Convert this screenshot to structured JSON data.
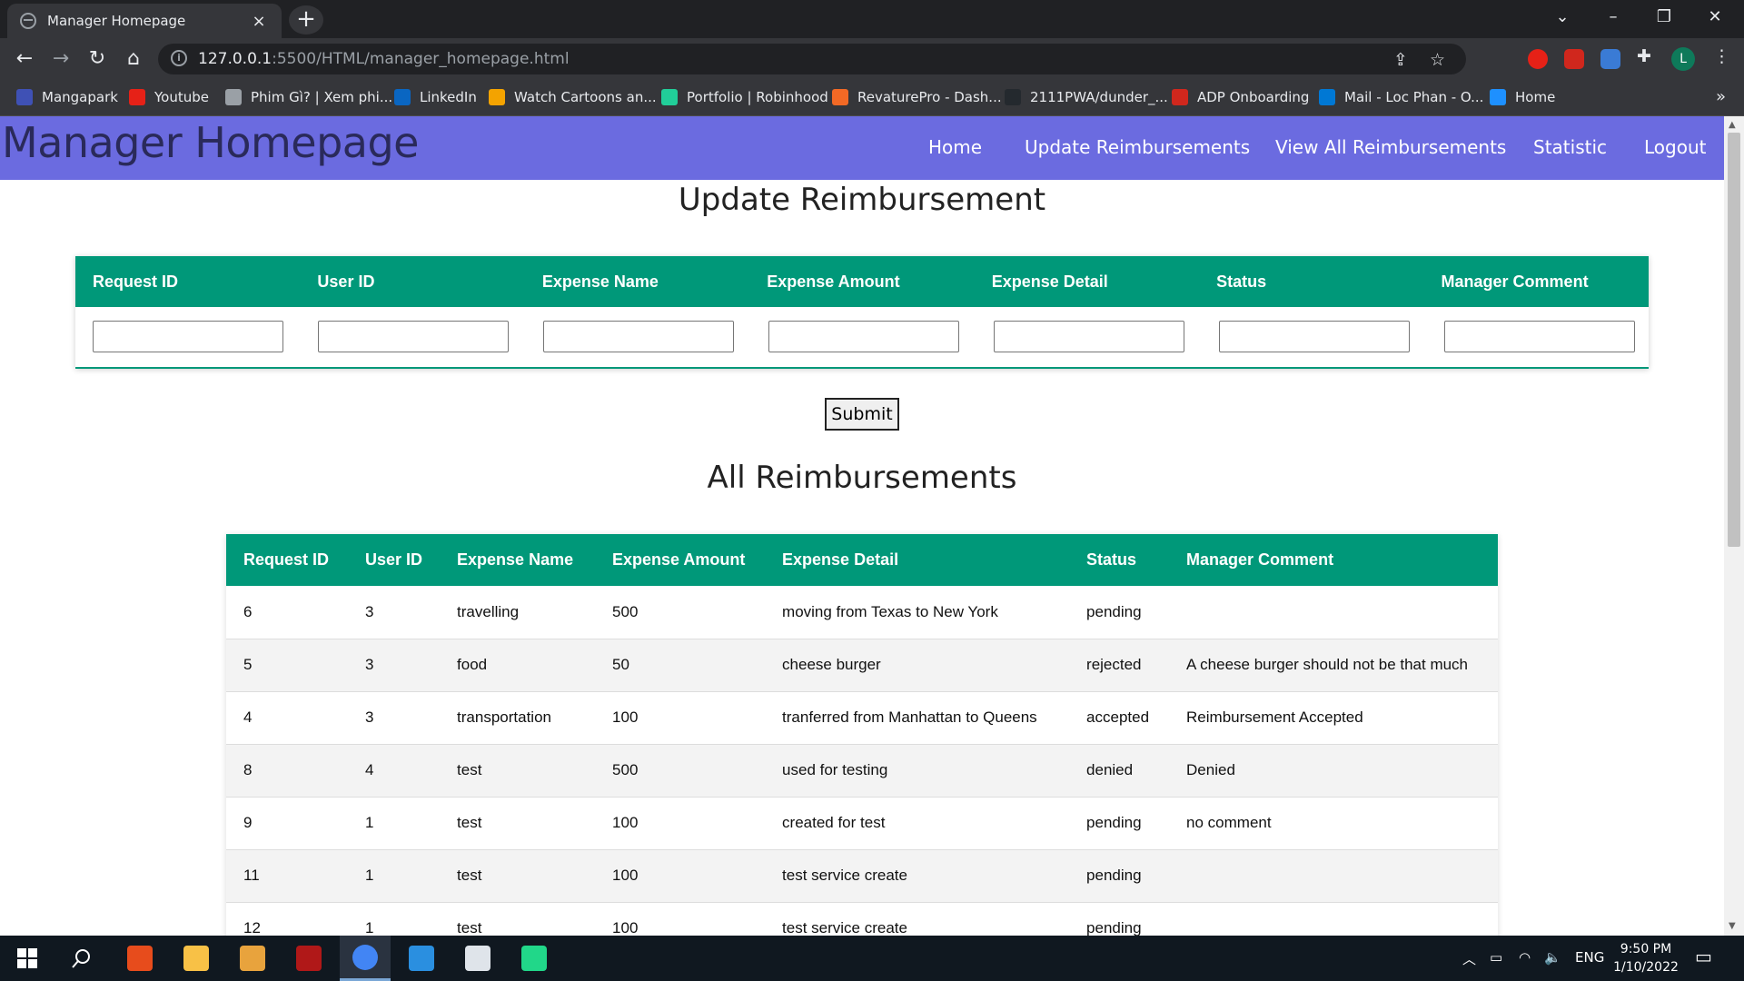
{
  "browser": {
    "tab_title": "Manager Homepage",
    "tab_close": "×",
    "new_tab": "+",
    "url_host": "127.0.0.1",
    "url_rest": ":5500/HTML/manager_homepage.html",
    "profile_initial": "L",
    "window_controls": {
      "chevron": "⌄",
      "minimize": "–",
      "restore": "❐",
      "close": "✕"
    },
    "nav": {
      "back": "←",
      "forward": "→",
      "reload": "↻",
      "home": "⌂"
    },
    "bookmarks": [
      {
        "label": "Mangapark",
        "icon": "mangapark-icon",
        "color": "#3f51b5"
      },
      {
        "label": "Youtube",
        "icon": "youtube-icon",
        "color": "#e62117"
      },
      {
        "label": "Phim Gì? | Xem phi...",
        "icon": "globe-icon",
        "color": "#9aa0a6"
      },
      {
        "label": "LinkedIn",
        "icon": "linkedin-icon",
        "color": "#0a66c2"
      },
      {
        "label": "Watch Cartoons an...",
        "icon": "cartoon-icon",
        "color": "#f4a300"
      },
      {
        "label": "Portfolio | Robinhood",
        "icon": "robinhood-icon",
        "color": "#21ce99"
      },
      {
        "label": "RevaturePro - Dash...",
        "icon": "revature-icon",
        "color": "#f26925"
      },
      {
        "label": "2111PWA/dunder_...",
        "icon": "github-icon",
        "color": "#24292e"
      },
      {
        "label": "ADP Onboarding",
        "icon": "adp-icon",
        "color": "#d0271d"
      },
      {
        "label": "Mail - Loc Phan - O...",
        "icon": "outlook-icon",
        "color": "#0078d4"
      },
      {
        "label": "Home",
        "icon": "cloud-icon",
        "color": "#1e90ff"
      }
    ],
    "bookmarks_more": "»"
  },
  "app": {
    "title": "Manager Homepage",
    "nav": [
      "Home",
      "Update Reimbursements",
      "View All Reimbursements",
      "Statistic",
      "Logout"
    ]
  },
  "update_section": {
    "title": "Update Reimbursement",
    "headers": [
      "Request ID",
      "User ID",
      "Expense Name",
      "Expense Amount",
      "Expense Detail",
      "Status",
      "Manager Comment"
    ],
    "values": [
      "",
      "",
      "",
      "",
      "",
      "",
      ""
    ],
    "submit_label": "Submit"
  },
  "all_section": {
    "title": "All Reimbursements",
    "headers": [
      "Request ID",
      "User ID",
      "Expense Name",
      "Expense Amount",
      "Expense Detail",
      "Status",
      "Manager Comment"
    ],
    "rows": [
      [
        "6",
        "3",
        "travelling",
        "500",
        "moving from Texas to New York",
        "pending",
        ""
      ],
      [
        "5",
        "3",
        "food",
        "50",
        "cheese burger",
        "rejected",
        "A cheese burger should not be that much"
      ],
      [
        "4",
        "3",
        "transportation",
        "100",
        "tranferred from Manhattan to Queens",
        "accepted",
        "Reimbursement Accepted"
      ],
      [
        "8",
        "4",
        "test",
        "500",
        "used for testing",
        "denied",
        "Denied"
      ],
      [
        "9",
        "1",
        "test",
        "100",
        "created for test",
        "pending",
        "no comment"
      ],
      [
        "11",
        "1",
        "test",
        "100",
        "test service create",
        "pending",
        ""
      ],
      [
        "12",
        "1",
        "test",
        "100",
        "test service create",
        "pending",
        ""
      ]
    ]
  },
  "taskbar": {
    "apps": [
      {
        "name": "office-icon",
        "color": "#e74c1c"
      },
      {
        "name": "file-explorer-icon",
        "color": "#f8c146"
      },
      {
        "name": "git-icon",
        "color": "#e8a33d"
      },
      {
        "name": "predator-icon",
        "color": "#b01818"
      },
      {
        "name": "chrome-icon",
        "color": "#4285f4"
      },
      {
        "name": "vscode-icon",
        "color": "#2a8fe0"
      },
      {
        "name": "pgadmin-icon",
        "color": "#dfe4ea"
      },
      {
        "name": "pycharm-icon",
        "color": "#21d789"
      }
    ],
    "language": "ENG",
    "time": "9:50 PM",
    "date": "1/10/2022"
  }
}
